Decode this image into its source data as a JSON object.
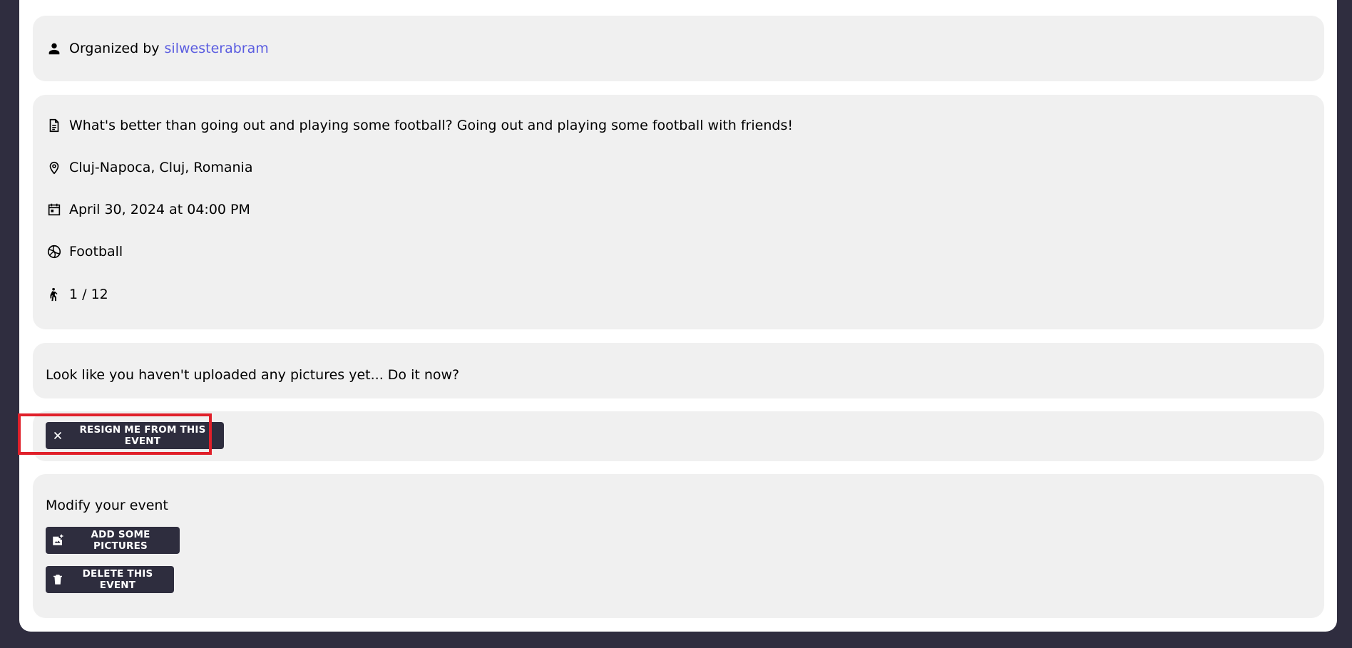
{
  "organizer": {
    "prefix": "Organized by",
    "username": "silwesterabram"
  },
  "details": {
    "description": "What's better than going out and playing some football? Going out and playing some football with friends!",
    "location": "Cluj-Napoca, Cluj, Romania",
    "datetime": "April 30, 2024 at 04:00 PM",
    "sport": "Football",
    "participants": "1 / 12"
  },
  "pictures": {
    "empty_message": "Look like you haven't uploaded any pictures yet... Do it now?"
  },
  "resign": {
    "label": "RESIGN ME FROM THIS EVENT"
  },
  "modify": {
    "title": "Modify your event",
    "add_pictures_label": "ADD SOME PICTURES",
    "delete_label": "DELETE THIS EVENT"
  },
  "icons": {
    "organizer": "person-icon",
    "description": "document-icon",
    "location": "location-pin-icon",
    "datetime": "calendar-icon",
    "sport": "sports-ball-icon",
    "participants": "person-running-icon",
    "resign": "close-icon",
    "add_pictures": "add-photo-icon",
    "delete": "trash-icon"
  },
  "colors": {
    "background": "#2f2d3f",
    "card": "#f0f0f0",
    "button": "#2e2d3e",
    "link": "#5a5ce0",
    "highlight": "#e0202a"
  }
}
